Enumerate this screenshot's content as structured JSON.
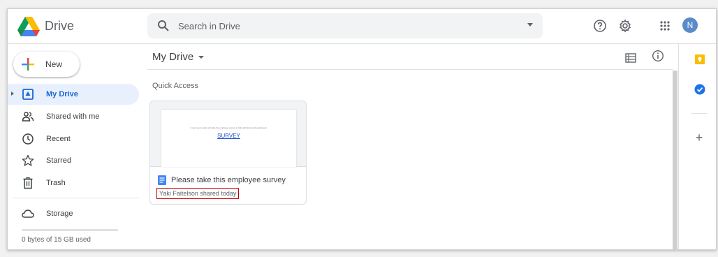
{
  "header": {
    "brand": "Drive",
    "search_placeholder": "Search in Drive",
    "avatar_initial": "N"
  },
  "sidebar": {
    "new_label": "New",
    "items": [
      {
        "label": "My Drive",
        "icon": "my-drive-icon",
        "active": true
      },
      {
        "label": "Shared with me",
        "icon": "people-icon",
        "active": false
      },
      {
        "label": "Recent",
        "icon": "clock-icon",
        "active": false
      },
      {
        "label": "Starred",
        "icon": "star-icon",
        "active": false
      },
      {
        "label": "Trash",
        "icon": "trash-icon",
        "active": false
      },
      {
        "label": "Storage",
        "icon": "cloud-icon",
        "active": false
      }
    ],
    "storage_used": "0 bytes of 15 GB used",
    "storage_fraction": 0
  },
  "main": {
    "title": "My Drive",
    "quick_access_label": "Quick Access",
    "card": {
      "preview_text": "I need you to sign and take the employee survey to help with internal development.",
      "preview_link": "SURVEY",
      "title": "Please take this employee survey",
      "meta": "Yaki Faitelson shared today"
    }
  },
  "colors": {
    "active_bg": "#e8f0fe",
    "active_text": "#1967d2",
    "highlight_box": "#cc0000",
    "docs_blue": "#4285f4",
    "keep_yellow": "#fbbc04",
    "tasks_blue": "#1a73e8"
  }
}
